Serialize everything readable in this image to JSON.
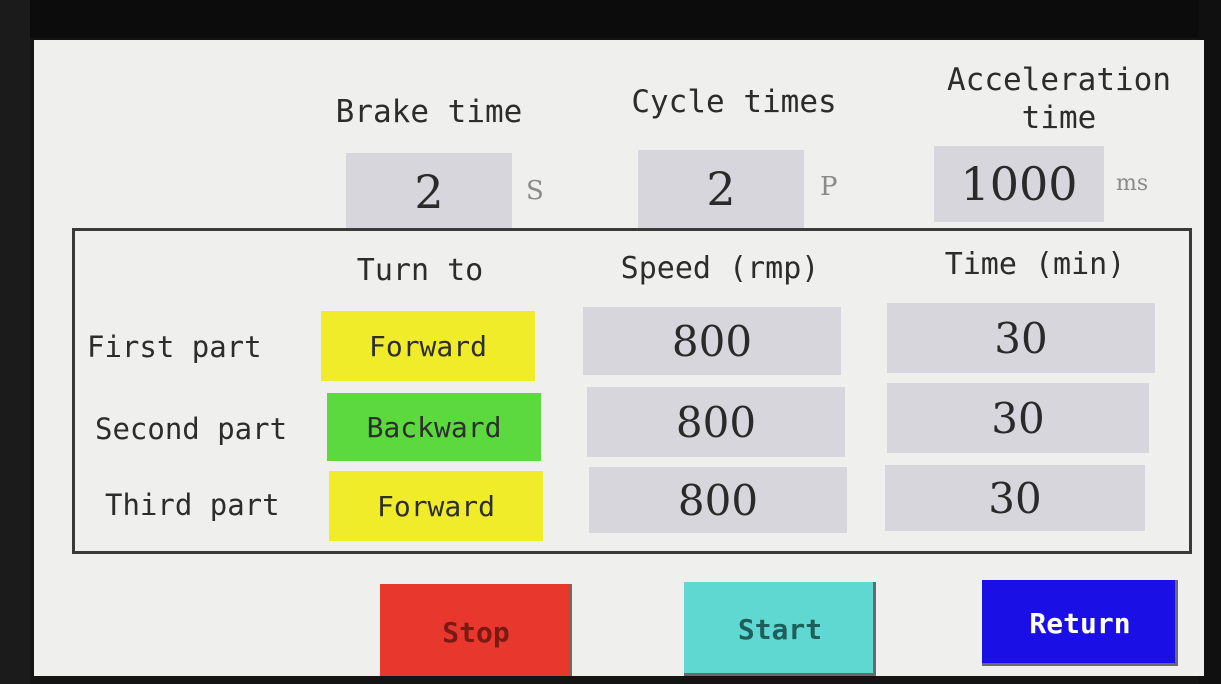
{
  "settings": {
    "brake_time": {
      "label": "Brake time",
      "value": "2",
      "unit": "S"
    },
    "cycle_times": {
      "label": "Cycle times",
      "value": "2",
      "unit": "P"
    },
    "acceleration_time": {
      "label_line1": "Acceleration",
      "label_line2": "time",
      "value": "1000",
      "unit": "ms"
    }
  },
  "table": {
    "headers": {
      "turn_to": "Turn to",
      "speed": "Speed (rmp)",
      "time": "Time (min)"
    },
    "rows": [
      {
        "label": "First part",
        "direction": "Forward",
        "speed": "800",
        "time": "30"
      },
      {
        "label": "Second part",
        "direction": "Backward",
        "speed": "800",
        "time": "30"
      },
      {
        "label": "Third part",
        "direction": "Forward",
        "speed": "800",
        "time": "30"
      }
    ]
  },
  "actions": {
    "stop": "Stop",
    "start": "Start",
    "return": "Return"
  },
  "colors": {
    "forward": "#f0ec2a",
    "backward": "#5cd93e",
    "stop": "#e8382e",
    "start": "#5fd8d2",
    "return": "#1a10e6",
    "screen_bg": "#efefee",
    "value_box": "#d6d6dc"
  }
}
